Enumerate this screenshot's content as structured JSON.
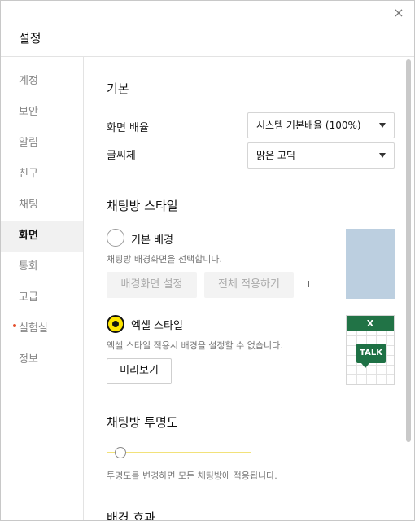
{
  "window": {
    "title": "설정",
    "close_label": "×"
  },
  "sidebar": {
    "items": [
      {
        "label": "계정"
      },
      {
        "label": "보안"
      },
      {
        "label": "알림"
      },
      {
        "label": "친구"
      },
      {
        "label": "채팅"
      },
      {
        "label": "화면",
        "active": true
      },
      {
        "label": "통화"
      },
      {
        "label": "고급"
      },
      {
        "label": "실험실",
        "has_dot": true
      },
      {
        "label": "정보"
      }
    ]
  },
  "basic": {
    "title": "기본",
    "zoom_label": "화면 배율",
    "zoom_value": "시스템 기본배율 (100%)",
    "font_label": "글씨체",
    "font_value": "맑은 고딕"
  },
  "chat_style": {
    "title": "채팅방 스타일",
    "default_bg_label": "기본 배경",
    "default_bg_desc": "채팅방 배경화면을 선택합니다.",
    "set_bg_button": "배경화면 설정",
    "apply_all_button": "전체 적용하기",
    "info_icon": "i",
    "excel_label": "엑셀 스타일",
    "excel_desc": "엑셀 스타일 적용시 배경을 설정할 수 없습니다.",
    "preview_button": "미리보기",
    "excel_preview_header": "X",
    "excel_preview_badge": "TALK",
    "selected": "excel"
  },
  "transparency": {
    "title": "채팅방 투명도",
    "desc": "투명도를 변경하면 모든 채팅방에 적용됩니다."
  },
  "next_section": {
    "title": "배경 효과"
  },
  "colors": {
    "accent": "#fee500",
    "excel_green": "#217346",
    "preview_blue": "#bccfe0",
    "lab_dot": "#e4502e"
  }
}
